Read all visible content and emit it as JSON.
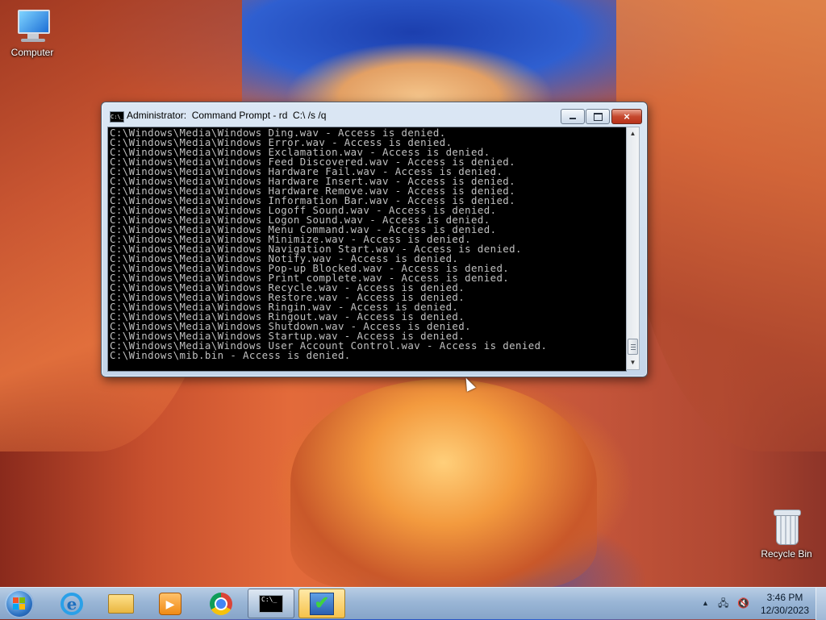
{
  "desktop": {
    "icons": [
      {
        "label": "Computer"
      },
      {
        "label": "Recycle Bin"
      }
    ]
  },
  "window": {
    "title": "Administrator:  Command Prompt - rd  C:\\ /s /q",
    "title_icon": "C:\\_",
    "controls": {
      "minimize": "minimize-icon",
      "maximize": "maximize-icon",
      "close": "×"
    },
    "console_lines": [
      "C:\\Windows\\Media\\Windows Ding.wav - Access is denied.",
      "C:\\Windows\\Media\\Windows Error.wav - Access is denied.",
      "C:\\Windows\\Media\\Windows Exclamation.wav - Access is denied.",
      "C:\\Windows\\Media\\Windows Feed Discovered.wav - Access is denied.",
      "C:\\Windows\\Media\\Windows Hardware Fail.wav - Access is denied.",
      "C:\\Windows\\Media\\Windows Hardware Insert.wav - Access is denied.",
      "C:\\Windows\\Media\\Windows Hardware Remove.wav - Access is denied.",
      "C:\\Windows\\Media\\Windows Information Bar.wav - Access is denied.",
      "C:\\Windows\\Media\\Windows Logoff Sound.wav - Access is denied.",
      "C:\\Windows\\Media\\Windows Logon Sound.wav - Access is denied.",
      "C:\\Windows\\Media\\Windows Menu Command.wav - Access is denied.",
      "C:\\Windows\\Media\\Windows Minimize.wav - Access is denied.",
      "C:\\Windows\\Media\\Windows Navigation Start.wav - Access is denied.",
      "C:\\Windows\\Media\\Windows Notify.wav - Access is denied.",
      "C:\\Windows\\Media\\Windows Pop-up Blocked.wav - Access is denied.",
      "C:\\Windows\\Media\\Windows Print complete.wav - Access is denied.",
      "C:\\Windows\\Media\\Windows Recycle.wav - Access is denied.",
      "C:\\Windows\\Media\\Windows Restore.wav - Access is denied.",
      "C:\\Windows\\Media\\Windows Ringin.wav - Access is denied.",
      "C:\\Windows\\Media\\Windows Ringout.wav - Access is denied.",
      "C:\\Windows\\Media\\Windows Shutdown.wav - Access is denied.",
      "C:\\Windows\\Media\\Windows Startup.wav - Access is denied.",
      "C:\\Windows\\Media\\Windows User Account Control.wav - Access is denied.",
      "C:\\Windows\\mib.bin - Access is denied."
    ],
    "console_text_color": "#c0c0c0",
    "console_bg_color": "#000000"
  },
  "taskbar": {
    "start_icon": "windows-start-orb",
    "pinned": [
      {
        "name": "internet-explorer-icon",
        "glyph": "e"
      },
      {
        "name": "file-explorer-icon"
      },
      {
        "name": "media-player-icon",
        "glyph": "▶"
      },
      {
        "name": "chrome-icon"
      },
      {
        "name": "command-prompt-icon",
        "glyph": "C:\\_"
      },
      {
        "name": "checkmark-app-icon",
        "glyph": "✔"
      }
    ],
    "tray": {
      "arrow": "▲",
      "network": "network-icon",
      "volume": "volume-muted-icon",
      "time": "3:46 PM",
      "date": "12/30/2023"
    }
  }
}
